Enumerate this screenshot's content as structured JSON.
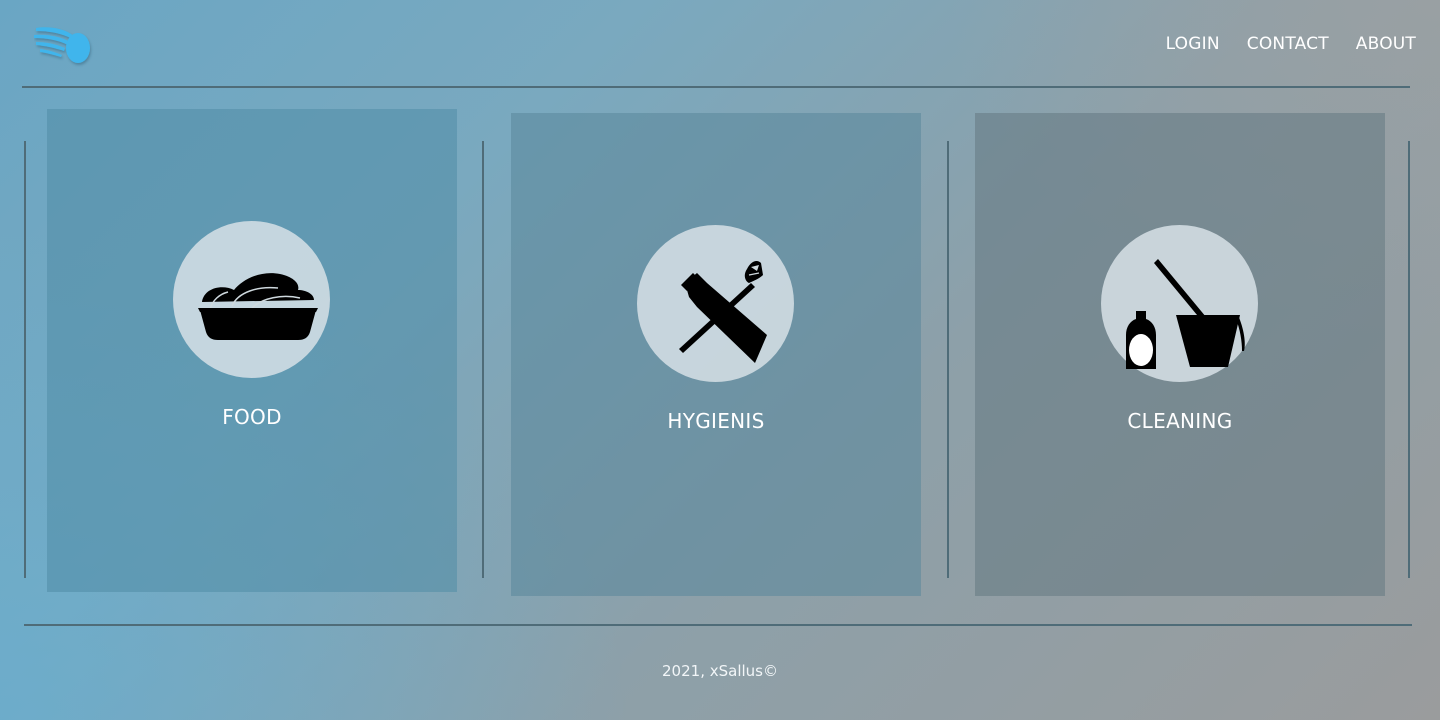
{
  "header": {
    "logo_icon": "wing-logo-icon",
    "nav": [
      {
        "label": "LOGIN"
      },
      {
        "label": "CONTACT"
      },
      {
        "label": "ABOUT"
      }
    ]
  },
  "cards": [
    {
      "label": "FOOD",
      "icon": "food-bowl-icon"
    },
    {
      "label": "HYGIENIS",
      "icon": "toothbrush-toothpaste-icon"
    },
    {
      "label": "CLEANING",
      "icon": "mop-bucket-bottle-icon"
    }
  ],
  "footer": {
    "copyright": "2021, xSallus©"
  },
  "colors": {
    "accent_logo": "#3fb5ec",
    "divider": "#4f6c78",
    "icon_circle": "#d7e1e6",
    "text": "#ffffff"
  }
}
